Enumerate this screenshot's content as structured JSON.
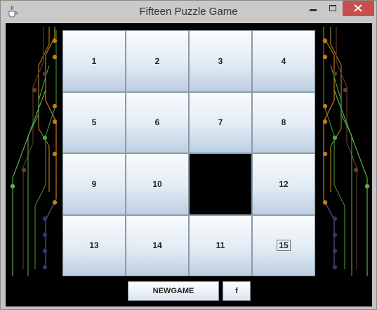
{
  "window": {
    "title": "Fifteen Puzzle Game",
    "icon": "java-cup-icon"
  },
  "board": {
    "tiles": [
      {
        "label": "1"
      },
      {
        "label": "2"
      },
      {
        "label": "3"
      },
      {
        "label": "4"
      },
      {
        "label": "5"
      },
      {
        "label": "6"
      },
      {
        "label": "7"
      },
      {
        "label": "8"
      },
      {
        "label": "9"
      },
      {
        "label": "10"
      },
      {
        "label": ""
      },
      {
        "label": "12"
      },
      {
        "label": "13"
      },
      {
        "label": "14"
      },
      {
        "label": "11"
      },
      {
        "label": "15"
      }
    ],
    "empty_index": 10,
    "focused_index": 15
  },
  "buttons": {
    "newgame": "NEWGAME",
    "f": "f"
  },
  "colors": {
    "background": "#000000",
    "close_button": "#c7504a"
  }
}
